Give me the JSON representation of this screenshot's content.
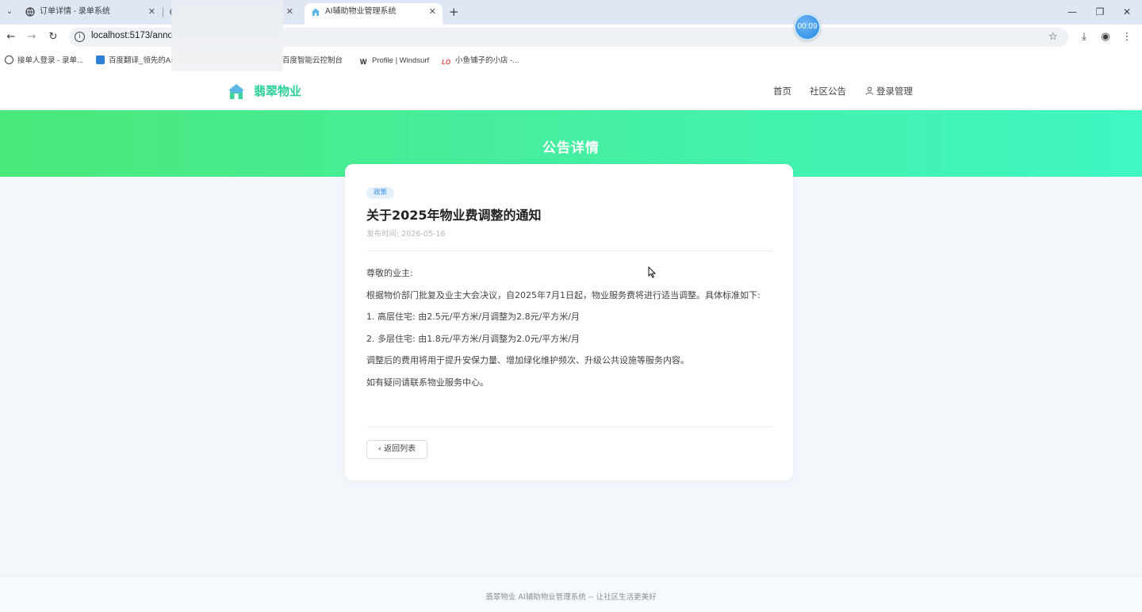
{
  "browser": {
    "tabs": [
      {
        "title": "订单详情 - 录单系统",
        "active": false
      },
      {
        "title": "",
        "active": false
      },
      {
        "title": "AI辅助物业管理系统",
        "active": true
      }
    ],
    "url": "localhost:5173/anno",
    "timer": "00:09",
    "bookmarks": [
      {
        "label": "接单人登录 - 录单...",
        "icon": "globe-icon"
      },
      {
        "label": "百度翻译_领先的AI...",
        "icon": "baidu-translate-icon"
      },
      {
        "label": "百度智能云控制台",
        "icon": "baidu-cloud-icon"
      },
      {
        "label": "Profile | Windsurf",
        "icon": "windsurf-icon"
      },
      {
        "label": "小鱼铺子的小店 -...",
        "icon": "shop-icon"
      }
    ]
  },
  "header": {
    "logo_text": "翡翠物业",
    "nav": {
      "home": "首页",
      "announcements": "社区公告",
      "login": "登录管理"
    }
  },
  "hero": {
    "title": "公告详情"
  },
  "article": {
    "tag": "政策",
    "title": "关于2025年物业费调整的通知",
    "date": "发布时间: 2026-05-16",
    "paragraphs": [
      "尊敬的业主:",
      "根据物价部门批复及业主大会决议，自2025年7月1日起，物业服务费将进行适当调整。具体标准如下:",
      "1. 高层住宅: 由2.5元/平方米/月调整为2.8元/平方米/月",
      "2. 多层住宅: 由1.8元/平方米/月调整为2.0元/平方米/月",
      "调整后的费用将用于提升安保力量、增加绿化维护频次、升级公共设施等服务内容。",
      "如有疑问请联系物业服务中心。"
    ],
    "back_label": "返回列表"
  },
  "footer": {
    "text": "翡翠物业 AI辅助物业管理系统 -- 让社区生活更美好"
  },
  "colors": {
    "brand": "#2bcf9a",
    "hero_start": "#4be87a",
    "hero_end": "#3ff7c2",
    "tag_bg": "#e4f1fd",
    "tag_text": "#3a8ee6"
  }
}
